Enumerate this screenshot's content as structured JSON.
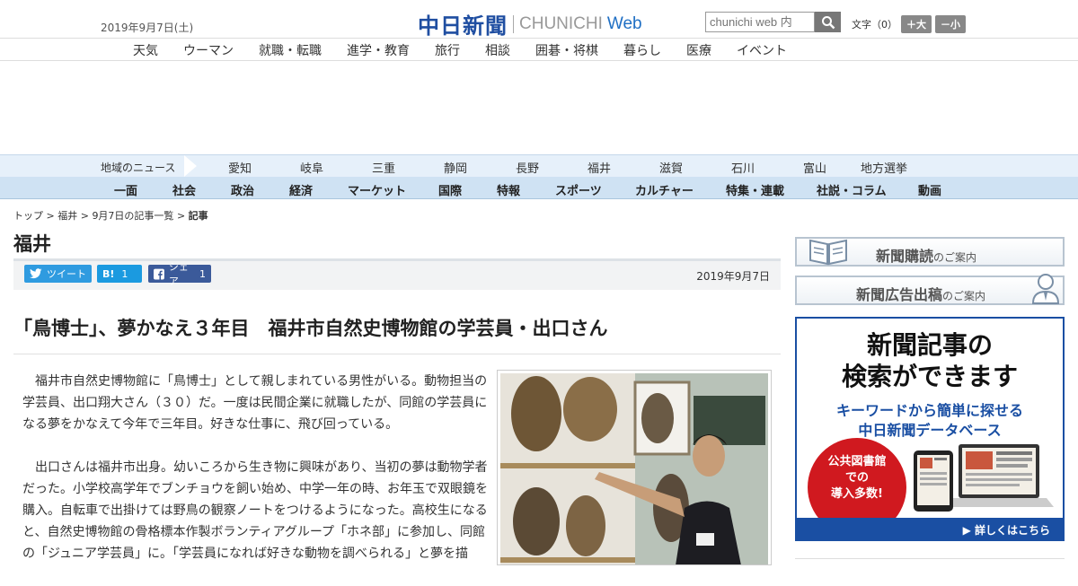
{
  "header": {
    "date": "2019年9月7日(土)",
    "logo_ja": "中日新聞",
    "logo_en": "CHUNICHI",
    "logo_web": "Web",
    "search_placeholder": "chunichi web 内",
    "textsize_label": "文字（0）",
    "textsize_larger": "＋大",
    "textsize_smaller": "－小"
  },
  "mainnav": [
    "天気",
    "ウーマン",
    "就職・転職",
    "進学・教育",
    "旅行",
    "相談",
    "囲碁・将棋",
    "暮らし",
    "医療",
    "イベント"
  ],
  "regionbar": {
    "label": "地域のニュース",
    "items": [
      "愛知",
      "岐阜",
      "三重",
      "静岡",
      "長野",
      "福井",
      "滋賀",
      "石川",
      "富山",
      "地方選挙"
    ]
  },
  "catbar": [
    "一面",
    "社会",
    "政治",
    "経済",
    "マーケット",
    "国際",
    "特報",
    "スポーツ",
    "カルチャー",
    "特集・連載",
    "社説・コラム",
    "動画"
  ],
  "breadcrumb": {
    "top": "トップ",
    "sep": ">",
    "region": "福井",
    "list": "9月7日の記事一覧",
    "current": "記事"
  },
  "section_title": "福井",
  "share": {
    "tweet_label": "ツイート",
    "hatena_label": "B!",
    "hatena_count": "1",
    "fb_label": "シェア",
    "fb_count": "1",
    "date": "2019年9月7日"
  },
  "article": {
    "headline": "「鳥博士」、夢かなえ３年目　福井市自然史博物館の学芸員・出口さん",
    "paragraphs": [
      "福井市自然史博物館に「鳥博士」として親しまれている男性がいる。動物担当の学芸員、出口翔大さん（３０）だ。一度は民間企業に就職したが、同館の学芸員になる夢をかなえて今年で三年目。好きな仕事に、飛び回っている。",
      "出口さんは福井市出身。幼いころから生き物に興味があり、当初の夢は動物学者だった。小学校高学年でブンチョウを飼い始め、中学一年の時、お年玉で双眼鏡を購入。自転車で出掛けては野鳥の観察ノートをつけるようになった。高校生になると、自然史博物館の骨格標本作製ボランティアグループ「ホネ部」に参加し、同館の「ジュニア学芸員」に。「学芸員になれば好きな動物を調べられる」と夢を描"
    ]
  },
  "sidebar": {
    "banner1": {
      "main": "新聞購読",
      "small": "のご案内"
    },
    "banner2": {
      "main": "新聞広告出稿",
      "small": "のご案内"
    },
    "ad": {
      "title_line1": "新聞記事の",
      "title_line2": "検索ができます",
      "sub_line1": "キーワードから簡単に探せる",
      "sub_line2": "中日新聞データベース",
      "circle_line1": "公共図書館",
      "circle_line2": "での",
      "circle_line3": "導入多数!",
      "cta": "詳しくはこちら"
    }
  }
}
